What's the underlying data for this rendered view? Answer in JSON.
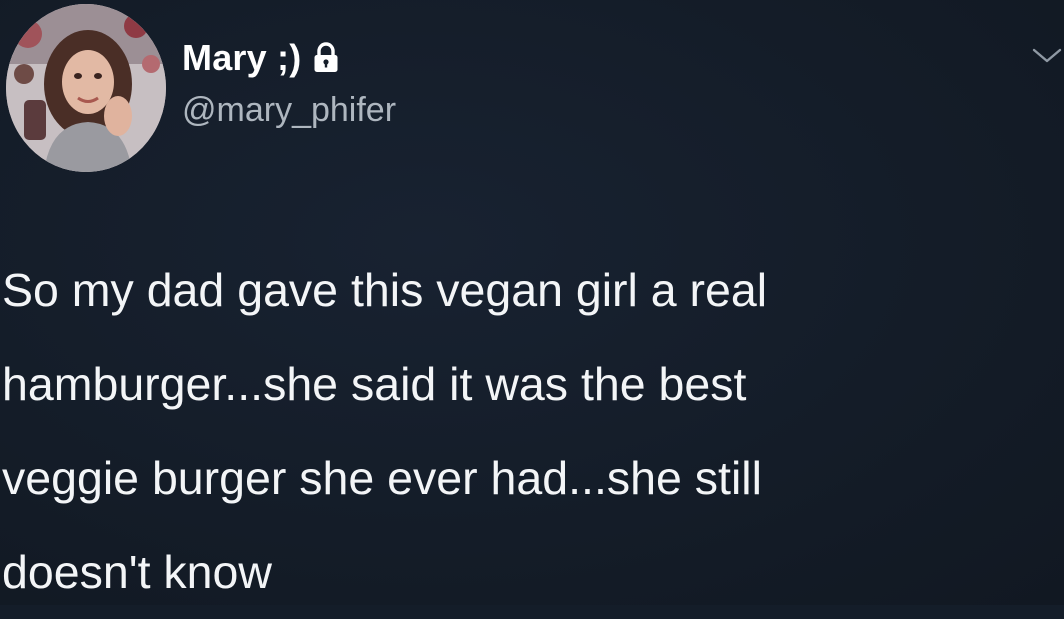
{
  "tweet": {
    "author": {
      "display_name": "Mary ;)",
      "handle": "@mary_phifer",
      "protected_icon": "lock-icon",
      "avatar_icon": "avatar"
    },
    "menu_icon": "chevron-down-icon",
    "text_lines": [
      "So my dad gave this vegan girl a real",
      "hamburger...she said it was the best",
      "veggie burger she ever had...she still",
      "doesn't know"
    ]
  },
  "colors": {
    "background": "#141d29",
    "primary_text": "#f3f5f7",
    "secondary_text": "#aeb6bf"
  }
}
